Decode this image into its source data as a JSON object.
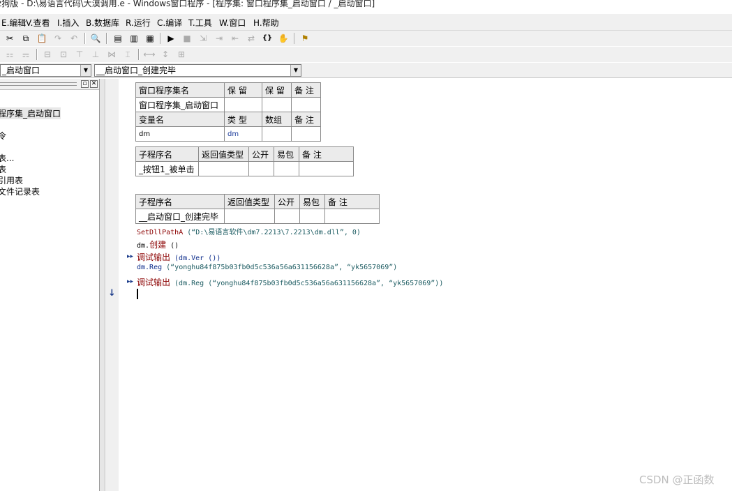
{
  "window": {
    "title": "ž狗版 - D:\\易语言代码\\大漠调用.e - Windows窗口程序 - [程序集: 窗口程序集_启动窗口 / _启动窗口]"
  },
  "menu": [
    {
      "label": "E.编辑"
    },
    {
      "label": "V.查看"
    },
    {
      "label": "I.插入"
    },
    {
      "label": "B.数据库"
    },
    {
      "label": "R.运行"
    },
    {
      "label": "C.编译"
    },
    {
      "label": "T.工具"
    },
    {
      "label": "W.窗口"
    },
    {
      "label": "H.帮助"
    }
  ],
  "toolbar1": {
    "cut_icon": "✂",
    "copy_icon": "⧉",
    "paste_icon": "📋",
    "redo_icon": "↷",
    "undo_icon": "↶",
    "find_icon": "🔍",
    "layout1_icon": "▤",
    "layout2_icon": "▥",
    "layout3_icon": "▦",
    "run_icon": "▶",
    "stop_icon": "■",
    "step1_icon": "⇲",
    "step2_icon": "⇥",
    "step3_icon": "⇤",
    "step4_icon": "⇄",
    "braces_icon": "{}",
    "hand_icon": "✋",
    "binoculars_icon": "⚑"
  },
  "toolbar2": {
    "a1": "⚏",
    "a2": "⚎",
    "a3": "⊟",
    "a4": "⊡",
    "a5": "⊤",
    "a6": "⊥",
    "a7": "⋈",
    "a8": "⌶",
    "a9": "⟷",
    "a10": "↕",
    "a11": "⊞"
  },
  "selectors": {
    "left": "_启动窗口",
    "right": "__启动窗口_创建完毕"
  },
  "tree": {
    "items": [
      "程序集_启动窗口",
      "令",
      "表...",
      "表",
      "引用表",
      "文件记录表"
    ]
  },
  "assembly_table": {
    "header": [
      "窗口程序集名",
      "保 留",
      "保 留",
      "备 注"
    ],
    "row": [
      "窗口程序集_启动窗口",
      "",
      "",
      ""
    ],
    "var_header": [
      "变量名",
      "类 型",
      "数组",
      "备 注"
    ],
    "var_row": [
      "dm",
      "dm",
      "",
      ""
    ]
  },
  "sub1": {
    "header": [
      "子程序名",
      "返回值类型",
      "公开",
      "易包",
      "备 注"
    ],
    "row": [
      "_按钮1_被单击",
      "",
      "",
      "",
      ""
    ]
  },
  "sub2": {
    "header": [
      "子程序名",
      "返回值类型",
      "公开",
      "易包",
      "备 注"
    ],
    "row": [
      "__启动窗口_创建完毕",
      "",
      "",
      "",
      ""
    ]
  },
  "code": {
    "l1_fn": "SetDllPathA",
    "l1_args": " (“D:\\易语言软件\\dm7.2213\\7.2213\\dm.dll”, 0)",
    "l2_obj": "dm.",
    "l2_fn": "创建",
    "l2_rest": " ()",
    "l3_fn": "调试输出",
    "l3_rest": " (dm.Ver ())",
    "l4_obj": "dm.Reg",
    "l4_args": " (“yonghu84f875b03fb0d5c536a56a631156628a”, “yk5657069”)",
    "l5_fn": "调试输出",
    "l5_rest": " (dm.Reg (“yonghu84f875b03fb0d5c536a56a631156628a”, “yk5657069”))",
    "marker": "▸▸",
    "arrow": "↓"
  },
  "watermark": "CSDN @正函数"
}
